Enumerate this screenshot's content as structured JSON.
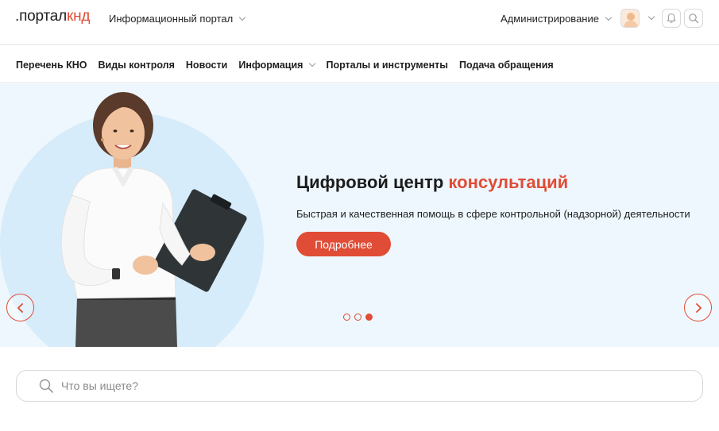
{
  "header": {
    "logo_prefix": ".портал",
    "logo_suffix": "кнд",
    "portal_select": "Информационный портал",
    "admin_select": "Администрирование"
  },
  "nav": {
    "items": [
      {
        "label": "Перечень КНО"
      },
      {
        "label": "Виды контроля"
      },
      {
        "label": "Новости"
      },
      {
        "label": "Информация",
        "has_dropdown": true
      },
      {
        "label": "Порталы и инструменты"
      },
      {
        "label": "Подача обращения"
      }
    ]
  },
  "hero": {
    "title_main": "Цифровой центр ",
    "title_accent": "консультаций",
    "subtitle": "Быстрая и качественная помощь в сфере контрольной (надзорной) деятельности",
    "button_label": "Подробнее",
    "slides_total": 3,
    "active_slide": 3
  },
  "search": {
    "placeholder": "Что вы ищете?"
  },
  "colors": {
    "accent": "#e04c36",
    "hero_bg": "#edf7fd"
  },
  "icons": {
    "bell": "bell-icon",
    "search": "search-icon",
    "prev": "chevron-left-icon",
    "next": "chevron-right-icon"
  }
}
